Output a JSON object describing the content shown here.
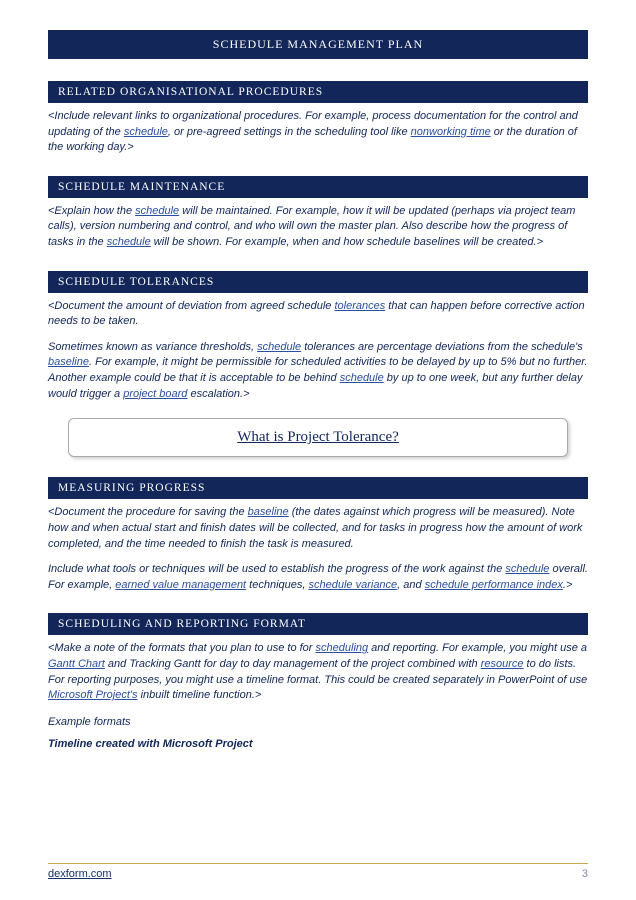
{
  "title": "SCHEDULE MANAGEMENT PLAN",
  "sections": {
    "related": {
      "header": "RELATED ORGANISATIONAL PROCEDURES",
      "p1a": "<Include relevant links to organizational procedures. For example, process documentation for the control and updating of the ",
      "link1": "schedule",
      "p1b": ", or pre-agreed settings in the scheduling tool like ",
      "link2": "nonworking time",
      "p1c": " or the duration of the working day.>"
    },
    "maintenance": {
      "header": "SCHEDULE MAINTENANCE",
      "p1a": "<Explain how the ",
      "link1": "schedule",
      "p1b": " will be maintained. For example, how it will be updated (perhaps via project team calls), version numbering and control, and who will own the master plan. Also describe how the progress of tasks in the ",
      "link2": "schedule",
      "p1c": " will be shown. For example, when and how schedule baselines will be created.>"
    },
    "tolerances": {
      "header": "SCHEDULE TOLERANCES",
      "p1a": "<Document the amount of deviation from agreed schedule ",
      "link1": "tolerances",
      "p1b": " that can happen before corrective action needs to be taken.",
      "p2a": "Sometimes known as variance thresholds, ",
      "link2": "schedule",
      "p2b": " tolerances are percentage deviations from the schedule's ",
      "link3": "baseline",
      "p2c": ". For example, it might be permissible for scheduled activities to be delayed by up to 5% but no further. Another example could be that it is acceptable to be behind ",
      "link4": "schedule",
      "p2d": " by up to one week, but any further delay would trigger a ",
      "link5": "project board",
      "p2e": " escalation.>",
      "callout": "What is Project Tolerance?"
    },
    "measuring": {
      "header": "MEASURING PROGRESS",
      "p1a": "<Document the procedure for saving the ",
      "link1": "baseline",
      "p1b": " (the dates against which progress will be measured). Note how and when actual start and finish dates will be collected, and for tasks in progress how the amount of work completed, and the time needed to finish the task is measured.",
      "p2a": "Include what tools or techniques will be used to establish the progress of the work against the ",
      "link2": "schedule",
      "p2b": " overall. For example, ",
      "link3": "earned value management",
      "p2c": " techniques, ",
      "link4": "schedule variance",
      "p2d": ", and ",
      "link5": "schedule performance index",
      "p2e": ".>"
    },
    "reporting": {
      "header": "SCHEDULING AND REPORTING FORMAT",
      "p1a": "<Make a note of the formats that you plan to use to for ",
      "link1": "scheduling",
      "p1b": " and reporting. For example, you might use a ",
      "link2": "Gantt Chart",
      "p1c": " and Tracking Gantt for day to day management of the project combined with ",
      "link3": "resource",
      "p1d": " to do lists. For reporting purposes, you might use a timeline format. This could be created separately in PowerPoint of use ",
      "link4": "Microsoft Project's",
      "p1e": " inbuilt timeline function.>",
      "example_label": "Example formats",
      "timeline_label": "Timeline created with Microsoft Project"
    }
  },
  "footer": {
    "site": "dexform.com",
    "page": "3"
  }
}
